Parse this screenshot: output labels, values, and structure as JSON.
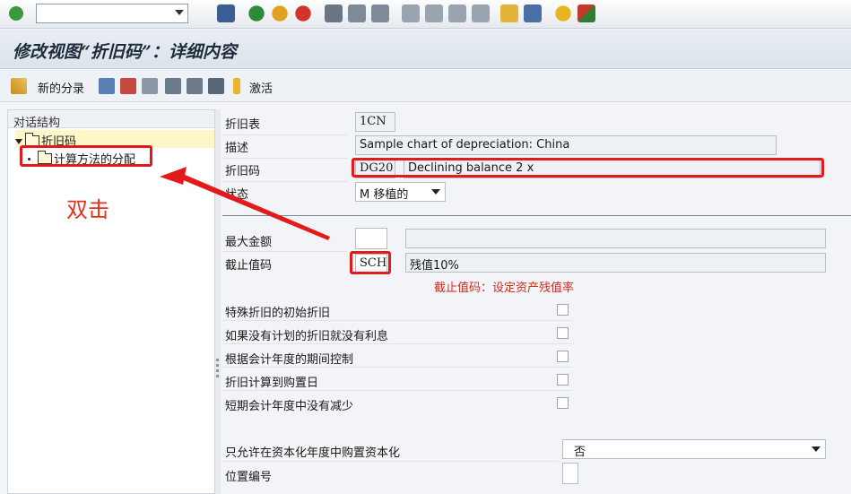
{
  "title": "修改视图“折旧码”：详细内容",
  "app_toolbar": {
    "new_entries": "新的分录",
    "activate": "激活"
  },
  "tree": {
    "header": "对话结构",
    "items": [
      {
        "label": "折旧码"
      },
      {
        "label": "计算方法的分配"
      }
    ]
  },
  "form": {
    "chart_label": "折旧表",
    "chart_value": "1CN",
    "desc_label": "描述",
    "desc_value": "Sample chart of depreciation: China",
    "code_label": "折旧码",
    "code_value": "DG20",
    "code_desc": "Declining balance 2 x",
    "status_label": "状态",
    "status_value": "M 移植的",
    "max_amount_label": "最大金额",
    "max_amount_value": "",
    "max_amount_desc": "",
    "cutoff_label": "截止值码",
    "cutoff_value": "SCH",
    "cutoff_desc": "残值10%",
    "checkboxes": [
      {
        "label": "特殊折旧的初始折旧",
        "checked": false
      },
      {
        "label": "如果没有计划的折旧就没有利息",
        "checked": false
      },
      {
        "label": "根据会计年度的期间控制",
        "checked": false
      },
      {
        "label": "折旧计算到购置日",
        "checked": false
      },
      {
        "label": "短期会计年度中没有减少",
        "checked": false
      }
    ],
    "cap_label": "只允许在资本化年度中购置资本化",
    "cap_value": "否",
    "position_label": "位置编号",
    "position_value": ""
  },
  "annotations": {
    "double_click": "双击",
    "cutoff_note": "截止值码：设定资产残值率"
  },
  "colors": {
    "annotation_red": "#e21a1a",
    "title_text": "#1f2a3a",
    "tree_highlight": "#fdf7c8"
  }
}
